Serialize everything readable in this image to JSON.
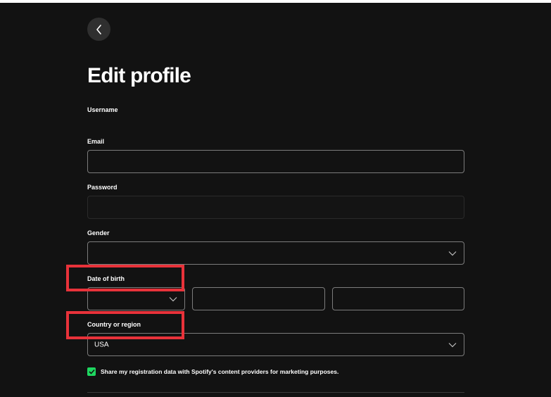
{
  "header": {
    "back_icon": "chevron-left-icon",
    "title": "Edit profile"
  },
  "form": {
    "username_label": "Username",
    "email_label": "Email",
    "email_value": "",
    "password_label": "Password",
    "password_value": "",
    "gender_label": "Gender",
    "gender_value": "",
    "dob_label": "Date of birth",
    "dob_month_value": "",
    "dob_day_value": "",
    "dob_year_value": "",
    "country_label": "Country or region",
    "country_value": "USA",
    "marketing_checkbox_label": "Share my registration data with Spotify's content providers for marketing purposes.",
    "marketing_checked": true
  },
  "annotations": {
    "highlight_color": "#e8323a",
    "highlighted_fields": [
      "Date of birth",
      "Country or region"
    ]
  },
  "colors": {
    "background": "#121212",
    "accent_green": "#1ed760",
    "input_border": "#7c7c7c"
  }
}
